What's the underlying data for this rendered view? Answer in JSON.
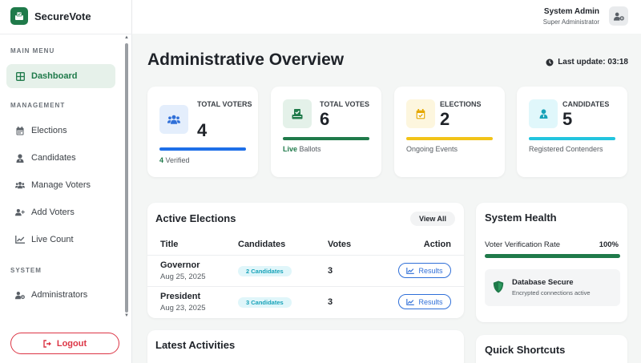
{
  "brand": {
    "name": "SecureVote"
  },
  "sidebar": {
    "main_menu_title": "MAIN MENU",
    "management_title": "MANAGEMENT",
    "system_title": "SYSTEM",
    "items": [
      {
        "label": "Dashboard",
        "icon": "dashboard-icon"
      },
      {
        "label": "Elections",
        "icon": "calendar-icon"
      },
      {
        "label": "Candidates",
        "icon": "user-tie-icon"
      },
      {
        "label": "Manage Voters",
        "icon": "users-icon"
      },
      {
        "label": "Add Voters",
        "icon": "user-plus-icon"
      },
      {
        "label": "Live Count",
        "icon": "chart-line-icon"
      },
      {
        "label": "Administrators",
        "icon": "user-gear-icon"
      }
    ],
    "logout_label": "Logout"
  },
  "topbar": {
    "user_name": "System Admin",
    "user_role": "Super Administrator"
  },
  "main": {
    "title": "Administrative Overview",
    "last_update": "Last update: 03:18",
    "stats": [
      {
        "label": "TOTAL VOTERS",
        "value": "4",
        "foot_strong": "4",
        "foot_text": " Verified",
        "bar_color": "#1e6fe8",
        "icon_bg": "#e4eefc",
        "icon_color": "#2f6fd8"
      },
      {
        "label": "TOTAL VOTES",
        "value": "6",
        "foot_strong": "Live",
        "foot_text": " Ballots",
        "bar_color": "#1f7a4a",
        "icon_bg": "#e4f1e9",
        "icon_color": "#1f7a4a"
      },
      {
        "label": "ELECTIONS",
        "value": "2",
        "foot_strong": "",
        "foot_text": "Ongoing Events",
        "bar_color": "#f2c318",
        "icon_bg": "#fdf6de",
        "icon_color": "#e5a800"
      },
      {
        "label": "CANDIDATES",
        "value": "5",
        "foot_strong": "",
        "foot_text": "Registered Contenders",
        "bar_color": "#22c4de",
        "icon_bg": "#e0f7fb",
        "icon_color": "#17a2b8"
      }
    ],
    "active_elections": {
      "title": "Active Elections",
      "view_all": "View All",
      "columns": [
        "Title",
        "Candidates",
        "Votes",
        "Action"
      ],
      "rows": [
        {
          "title": "Governor",
          "date": "Aug 25, 2025",
          "candidates": "2 Candidates",
          "votes": "3",
          "action": "Results"
        },
        {
          "title": "President",
          "date": "Aug 23, 2025",
          "candidates": "3 Candidates",
          "votes": "3",
          "action": "Results"
        }
      ]
    },
    "latest_activities": {
      "title": "Latest Activities"
    },
    "system_health": {
      "title": "System Health",
      "verification_label": "Voter Verification Rate",
      "verification_value": "100%",
      "verification_fraction": 1.0,
      "db_title": "Database Secure",
      "db_subtitle": "Encrypted connections active"
    },
    "quick_shortcuts": {
      "title": "Quick Shortcuts"
    }
  },
  "colors": {
    "brand": "#1f7a4a",
    "danger": "#dc3545",
    "primary": "#2f6fd8",
    "info": "#17a2b8"
  }
}
